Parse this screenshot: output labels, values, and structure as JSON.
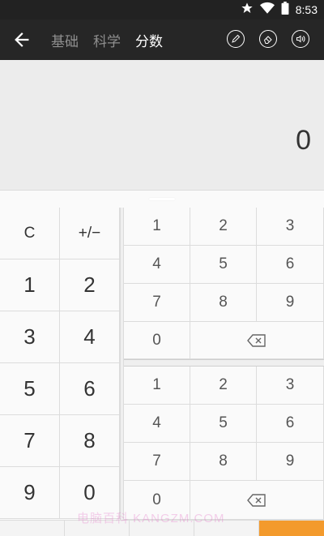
{
  "status_bar": {
    "time": "8:53",
    "icons": [
      "star-icon",
      "wifi-icon",
      "battery-icon"
    ]
  },
  "app_bar": {
    "tabs": [
      {
        "label": "基础",
        "active": false
      },
      {
        "label": "科学",
        "active": false
      },
      {
        "label": "分数",
        "active": true
      }
    ],
    "actions": [
      "pencil-icon",
      "eraser-icon",
      "sound-icon"
    ]
  },
  "display": {
    "value": "0"
  },
  "left_keypad": [
    "C",
    "+/−",
    "1",
    "2",
    "3",
    "4",
    "5",
    "6",
    "7",
    "8",
    "9",
    "0"
  ],
  "numerator_keypad": [
    "1",
    "2",
    "3",
    "4",
    "5",
    "6",
    "7",
    "8",
    "9",
    "0"
  ],
  "denominator_keypad": [
    "1",
    "2",
    "3",
    "4",
    "5",
    "6",
    "7",
    "8",
    "9",
    "0"
  ],
  "watermark": "电脑百科 KANGZM.COM",
  "colors": {
    "app_bar": "#262626",
    "display_bg": "#ececec",
    "accent": "#f39a2c",
    "inactive_tab": "#8f8f8f"
  }
}
